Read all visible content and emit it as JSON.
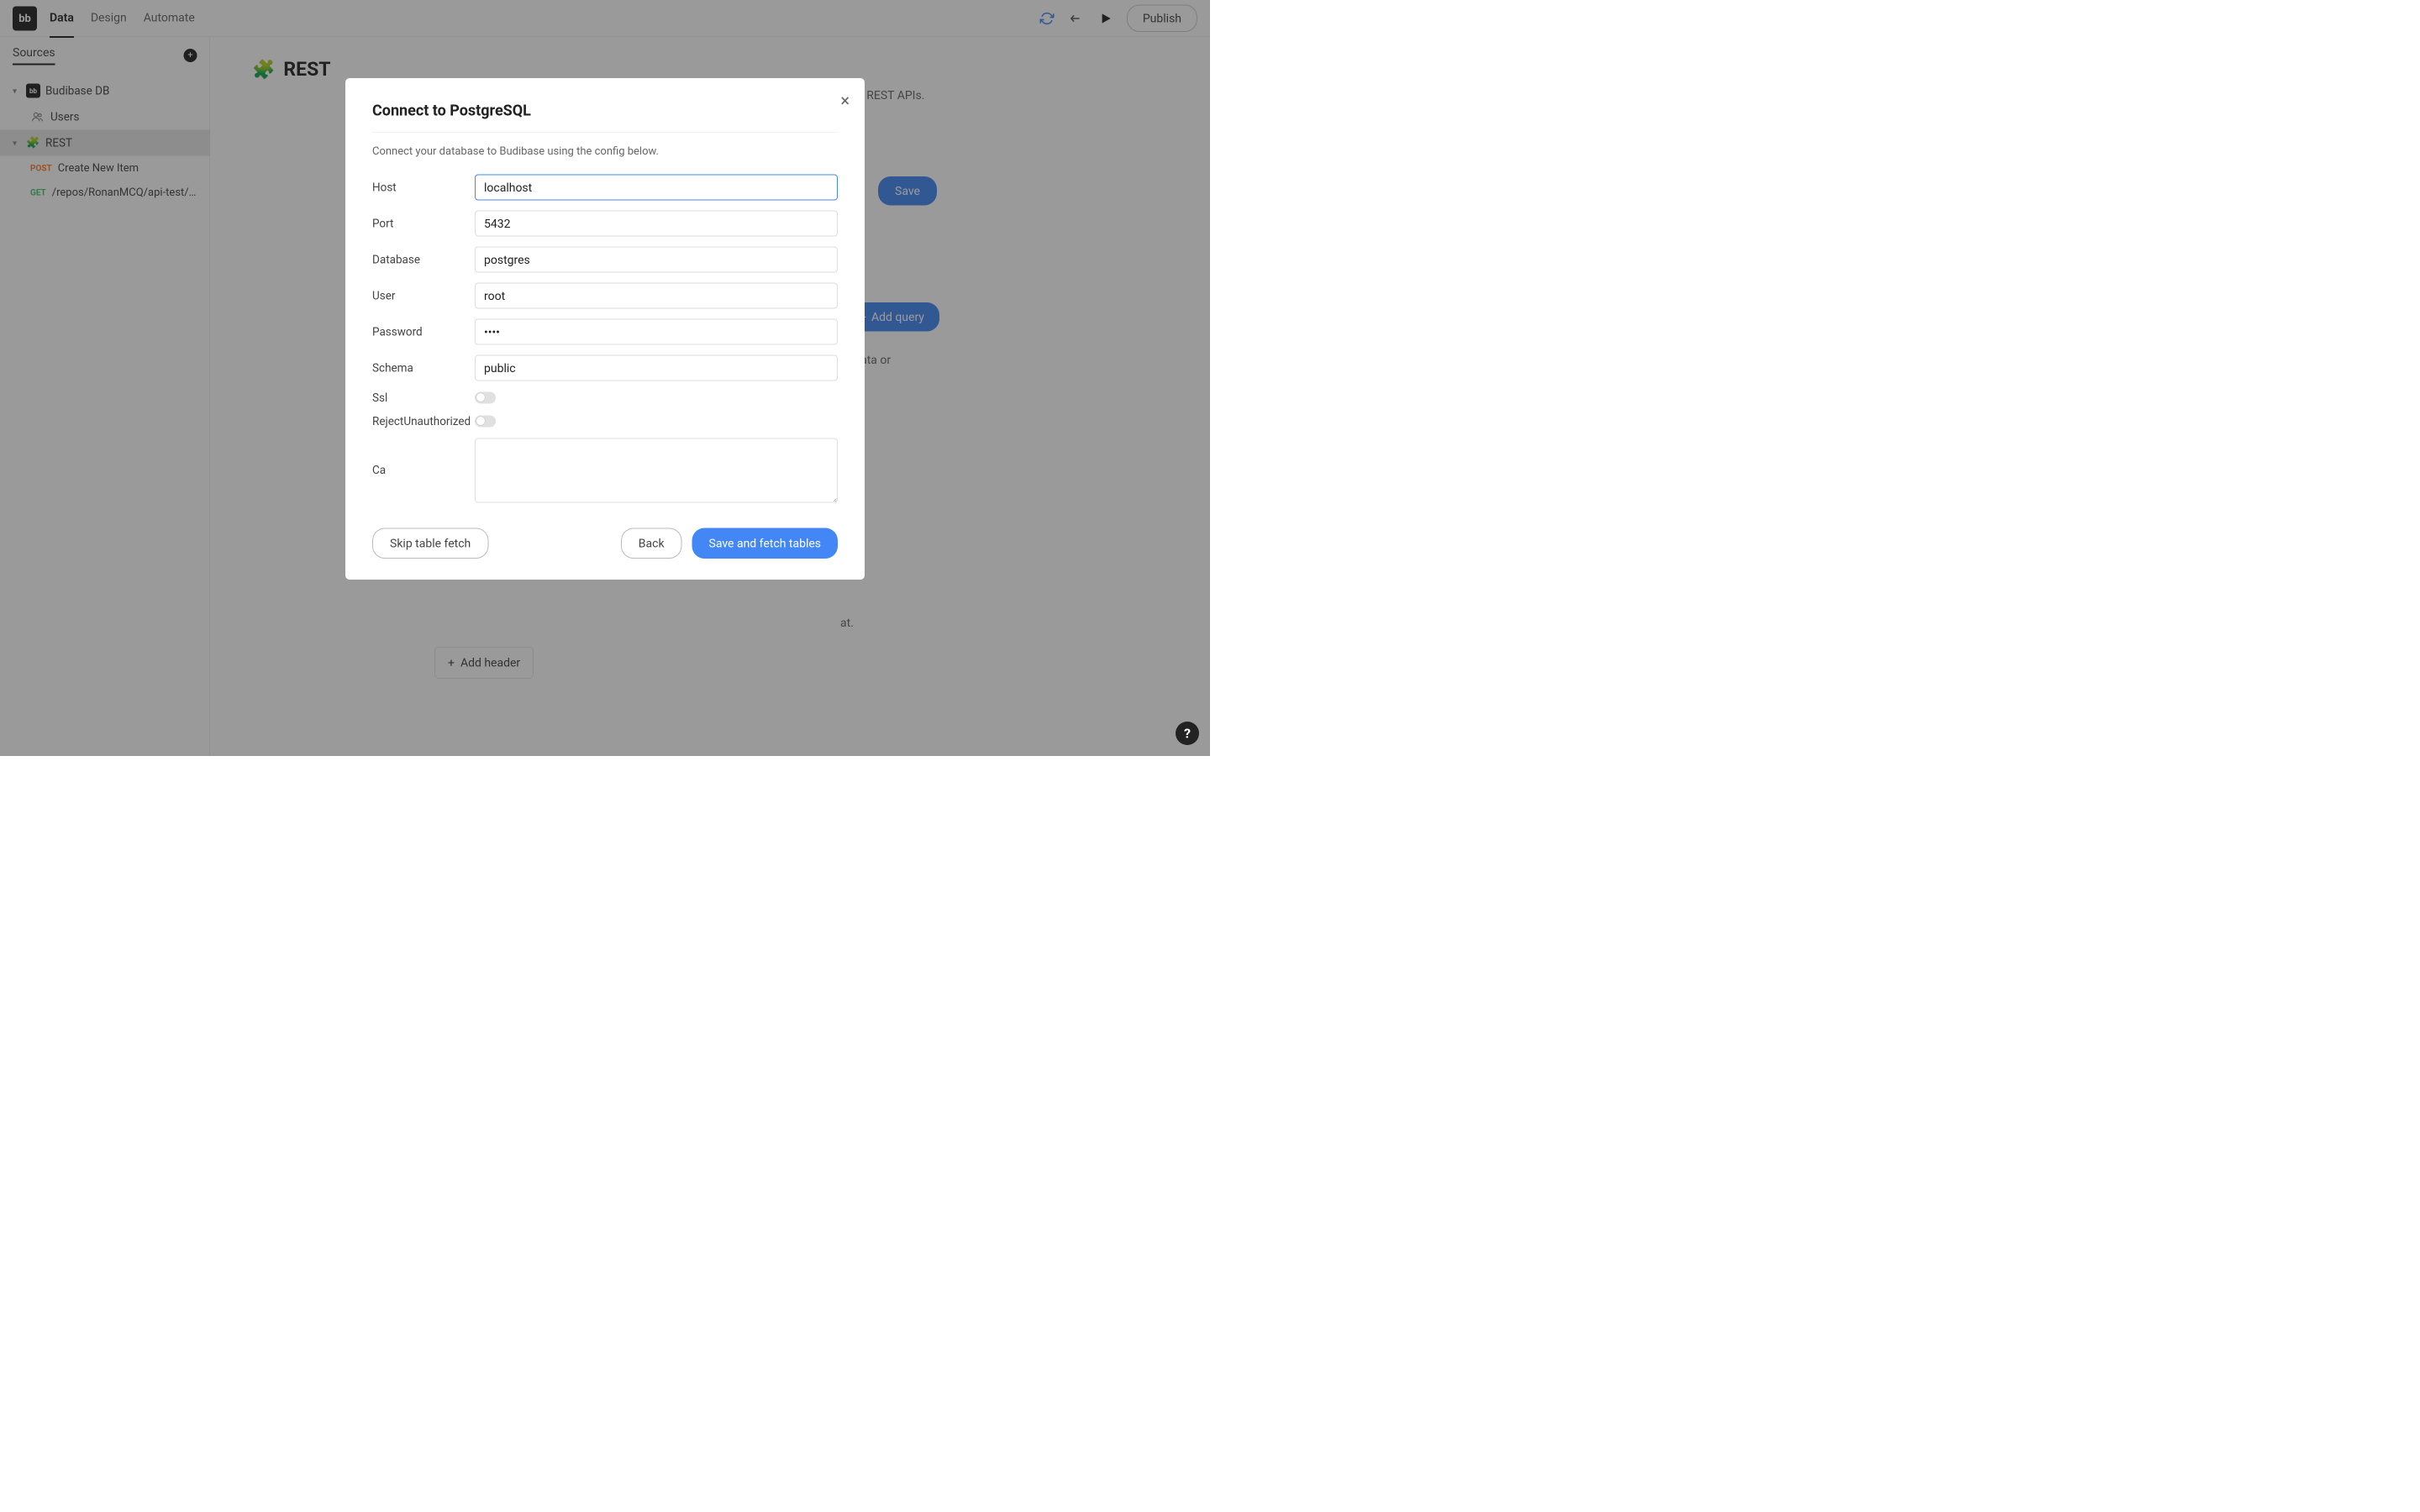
{
  "topbar": {
    "logo_text": "bb",
    "tabs": [
      "Data",
      "Design",
      "Automate"
    ],
    "active_tab": 0,
    "publish_label": "Publish"
  },
  "sidebar": {
    "title": "Sources",
    "items": [
      {
        "label": "Budibase DB",
        "icon": "bb"
      },
      {
        "label": "Users",
        "icon": "users"
      },
      {
        "label": "REST",
        "icon": "rest",
        "selected": true
      },
      {
        "method": "POST",
        "label": "Create New Item"
      },
      {
        "method": "GET",
        "label": "/repos/RonanMCQ/api-test/i..."
      }
    ]
  },
  "content": {
    "title": "REST",
    "subtitle_fragment": "ultiple REST APIs.",
    "save_label": "Save",
    "add_query_label": "Add query",
    "frag_data_or": "or data or",
    "frag_at": "at.",
    "add_header_label": "Add header"
  },
  "modal": {
    "title": "Connect to PostgreSQL",
    "description": "Connect your database to Budibase using the config below.",
    "fields": {
      "host": {
        "label": "Host",
        "value": "localhost"
      },
      "port": {
        "label": "Port",
        "value": "5432"
      },
      "database": {
        "label": "Database",
        "value": "postgres"
      },
      "user": {
        "label": "User",
        "value": "root"
      },
      "password": {
        "label": "Password",
        "value": "••••"
      },
      "schema": {
        "label": "Schema",
        "value": "public"
      },
      "ssl": {
        "label": "Ssl",
        "value": false
      },
      "reject_unauthorized": {
        "label": "RejectUnauthorized",
        "value": false
      },
      "ca": {
        "label": "Ca",
        "value": ""
      }
    },
    "buttons": {
      "skip": "Skip table fetch",
      "back": "Back",
      "save_fetch": "Save and fetch tables"
    }
  },
  "help": "?"
}
